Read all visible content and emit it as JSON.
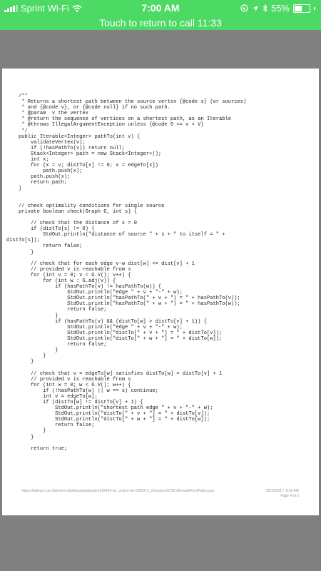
{
  "status_bar": {
    "carrier": "Sprint Wi-Fi",
    "time": "7:00 AM",
    "battery": "55%",
    "battery_level": 0.55,
    "icons": [
      "signal-icon",
      "wifi-icon",
      "orientation-lock-icon",
      "location-icon",
      "bluetooth-icon",
      "battery-icon"
    ]
  },
  "call_banner": {
    "text": "Touch to return to call 11:33"
  },
  "document": {
    "code_lines": [
      "    /**",
      "     * Returns a shortest path between the source vertex {@code s} (or sources)",
      "     * and {@code v}, or {@code null} if no such path.",
      "     * @param  v the vertex",
      "     * @return the sequence of vertices on a shortest path, as an Iterable",
      "     * @throws IllegalArgumentException unless {@code 0 <= v < V}",
      "     */",
      "    public Iterable<Integer> pathTo(int v) {",
      "        validateVertex(v);",
      "        if (!hasPathTo(v)) return null;",
      "        Stack<Integer> path = new Stack<Integer>();",
      "        int x;",
      "        for (x = v; distTo[x] != 0; x = edgeTo[x])",
      "            path.push(x);",
      "        path.push(x);",
      "        return path;",
      "    }",
      "",
      "",
      "    // check optimality conditions for single source",
      "    private boolean check(Graph G, int s) {",
      "",
      "        // check that the distance of s = 0",
      "        if (distTo[s] != 0) {",
      "            StdOut.println(\"distance of source \" + s + \" to itself = \" +",
      "distTo[s]);",
      "            return false;",
      "        }",
      "",
      "        // check that for each edge v-w dist[w] <= dist[v] + 1",
      "        // provided v is reachable from s",
      "        for (int v = 0; v < G.V(); v++) {",
      "            for (int w : G.adj(v)) {",
      "                if (hasPathTo(v) != hasPathTo(w)) {",
      "                    StdOut.println(\"edge \" + v + \"-\" + w);",
      "                    StdOut.println(\"hasPathTo(\" + v + \") = \" + hasPathTo(v));",
      "                    StdOut.println(\"hasPathTo(\" + w + \") = \" + hasPathTo(w));",
      "                    return false;",
      "                }",
      "                if (hasPathTo(v) && (distTo[w] > distTo[v] + 1)) {",
      "                    StdOut.println(\"edge \" + v + \"-\" + w);",
      "                    StdOut.println(\"distTo[\" + v + \"] = \" + distTo[v]);",
      "                    StdOut.println(\"distTo[\" + w + \"] = \" + distTo[w]);",
      "                    return false;",
      "                }",
      "            }",
      "        }",
      "",
      "        // check that v = edgeTo[w] satisfies distTo[w] = distTo[v] + 1",
      "        // provided v is reachable from s",
      "        for (int w = 0; w < G.V(); w++) {",
      "            if (!hasPathTo(w) || w == s) continue;",
      "            int v = edgeTo[w];",
      "            if (distTo[w] != distTo[v] + 1) {",
      "                StdOut.println(\"shortest path edge \" + v + \"-\" + w);",
      "                StdOut.println(\"distTo[\" + v + \"] = \" + distTo[v]);",
      "                StdOut.println(\"distTo[\" + w + \"] = \" + distTo[w]);",
      "                return false;",
      "            }",
      "        }",
      "",
      "        return true;"
    ],
    "footer_url": "https://bblearn.csu.fullerton.edu/bbcswebdav/pid-818449-dt...ontent-rid-4366373_2/courses/67951/BreadthFirstPaths.java",
    "footer_date": "28/10/2017, 6:59 AM",
    "footer_page": "Page 4 of 5"
  }
}
